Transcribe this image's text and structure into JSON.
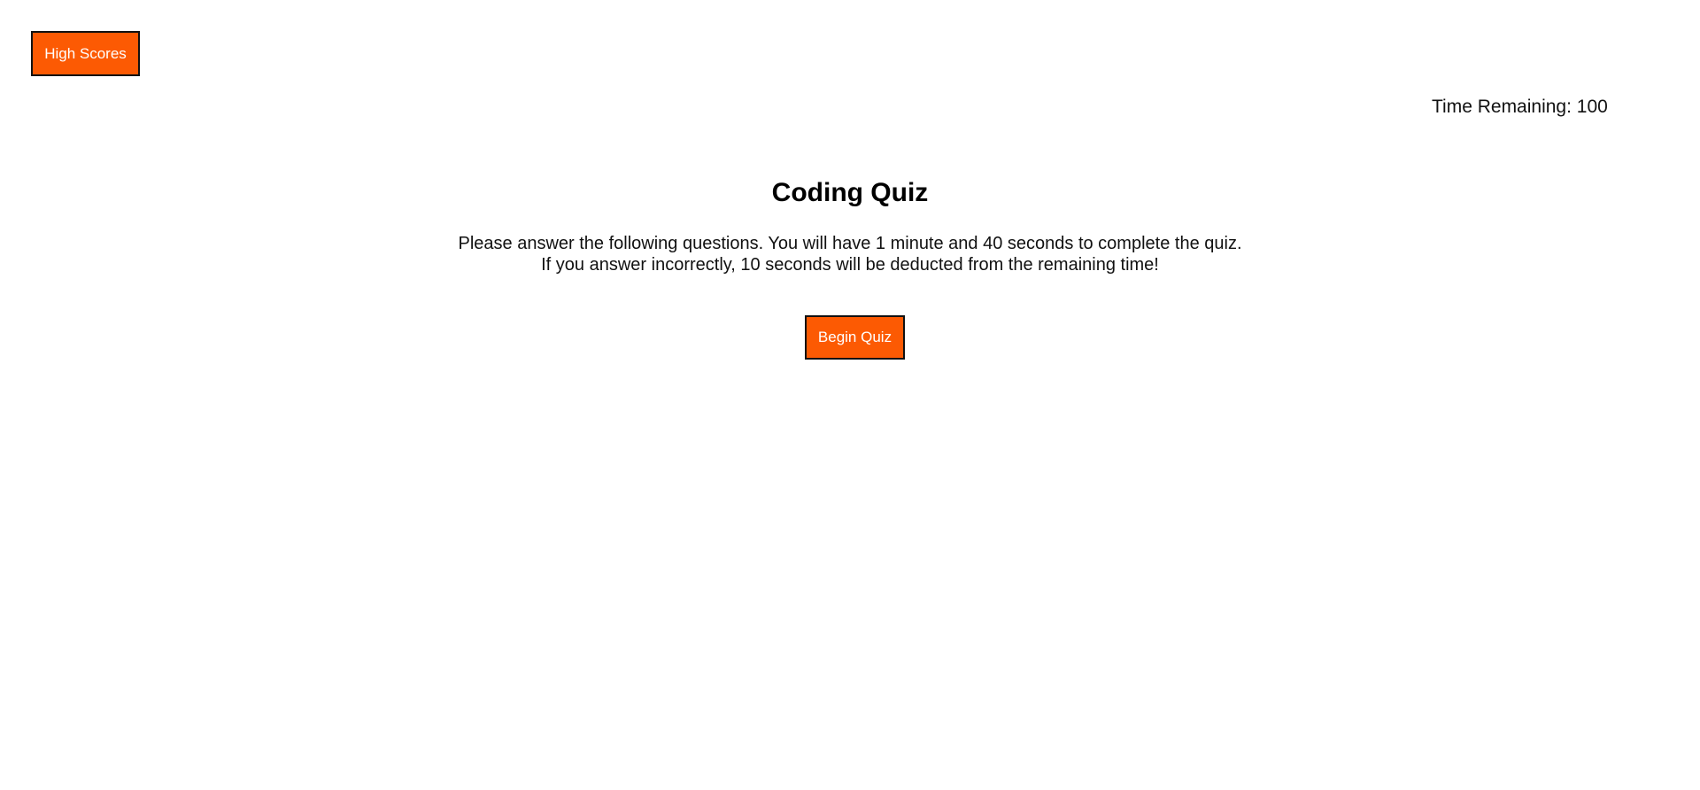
{
  "header": {
    "high_scores_label": "High Scores",
    "timer_label": "Time Remaining: ",
    "timer_value": "100"
  },
  "main": {
    "title": "Coding Quiz",
    "description_line1": "Please answer the following questions. You will have 1 minute and 40 seconds to complete the quiz.",
    "description_line2": "If you answer incorrectly, 10 seconds will be deducted from the remaining time!",
    "begin_label": "Begin Quiz"
  },
  "colors": {
    "accent": "#fc5a03",
    "button_text": "#ffffff",
    "border": "#111111",
    "background": "#ffffff"
  }
}
